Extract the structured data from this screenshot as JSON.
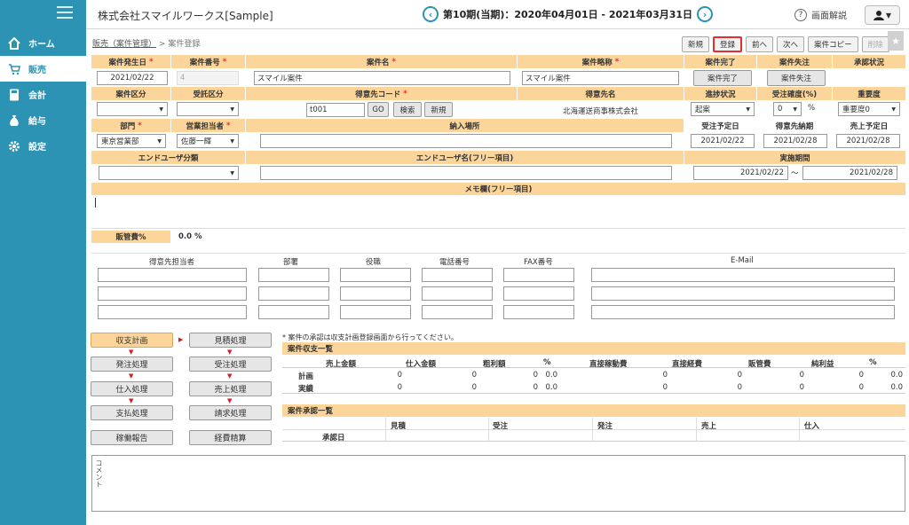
{
  "sidebar": {
    "items": [
      {
        "label": "ホーム",
        "icon": "home-icon"
      },
      {
        "label": "販売",
        "icon": "cart-icon"
      },
      {
        "label": "会計",
        "icon": "calculator-icon"
      },
      {
        "label": "給与",
        "icon": "money-bag-icon"
      },
      {
        "label": "設定",
        "icon": "gear-icon"
      }
    ],
    "active": 1
  },
  "header": {
    "company": "株式会社スマイルワークス[Sample]",
    "period": "第10期(当期)：2020年04月01日 - 2021年03月31日",
    "help": "画面解説"
  },
  "breadcrumb": {
    "parent": "販売（案件管理）",
    "sep": ">",
    "current": "案件登録"
  },
  "toolbar": {
    "new": "新規",
    "register": "登録",
    "prev": "前へ",
    "next": "次へ",
    "copy": "案件コピー",
    "delete": "削除"
  },
  "form": {
    "labels": {
      "date": "案件発生日",
      "number": "案件番号",
      "name": "案件名",
      "short": "案件略称",
      "complete": "案件完了",
      "lost": "案件失注",
      "approval": "承認状況",
      "category": "案件区分",
      "order_type": "受託区分",
      "customer_code": "得意先コード",
      "customer_name": "得意先名",
      "progress": "進捗状況",
      "probability": "受注確度(%)",
      "importance": "重要度",
      "dept": "部門",
      "staff": "営業担当者",
      "delivery_place": "納入場所",
      "order_date": "受注予定日",
      "delivery_date": "得意先納期",
      "sales_date": "売上予定日",
      "enduser_type": "エンドユーザ分類",
      "enduser_name": "エンドユーザ名(フリー項目)",
      "period": "実施期間",
      "memo": "メモ欄(フリー項目)",
      "sga": "販管費%"
    },
    "required_mark": "*",
    "values": {
      "date": "2021/02/22",
      "number": "4",
      "name": "スマイル案件",
      "short": "スマイル案件",
      "complete_btn": "案件完了",
      "lost_btn": "案件失注",
      "customer_code": "t001",
      "go": "GO",
      "search": "検索",
      "new": "新規",
      "customer_name": "北海運送商事株式会社",
      "progress": "起案",
      "probability": "0",
      "percent": "%",
      "importance": "重要度0",
      "dept": "東京営業部",
      "staff": "佐藤一輝",
      "order_date": "2021/02/22",
      "delivery_date": "2021/02/28",
      "sales_date": "2021/02/28",
      "period_start": "2021/02/22",
      "tilde": "～",
      "period_end": "2021/02/28",
      "sga": "0.0 %"
    }
  },
  "contacts": {
    "headers": [
      "得意先担当者",
      "部署",
      "役職",
      "電話番号",
      "FAX番号",
      "E-Mail"
    ]
  },
  "flow": {
    "buttons": [
      "収支計画",
      "見積処理",
      "発注処理",
      "受注処理",
      "仕入処理",
      "売上処理",
      "支払処理",
      "請求処理",
      "稼働報告",
      "経費精算"
    ],
    "note": "* 案件の承認は収支計画登録画面から行ってください。"
  },
  "summary": {
    "title": "案件収支一覧",
    "headers": [
      "売上金額",
      "仕入金額",
      "粗利額",
      "%",
      "直接稼動費",
      "直接経費",
      "販管費",
      "純利益",
      "%"
    ],
    "rows": [
      {
        "label": "計画",
        "values": [
          "0",
          "0",
          "0",
          "0.0",
          "0",
          "0",
          "0",
          "0",
          "0.0"
        ]
      },
      {
        "label": "実績",
        "values": [
          "0",
          "0",
          "0",
          "0.0",
          "0",
          "0",
          "0",
          "0",
          "0.0"
        ]
      }
    ]
  },
  "approvals": {
    "title": "案件承認一覧",
    "headers": [
      "見積",
      "受注",
      "発注",
      "売上",
      "仕入"
    ],
    "row_label": "承認日"
  },
  "comment": {
    "label": "コメント"
  }
}
